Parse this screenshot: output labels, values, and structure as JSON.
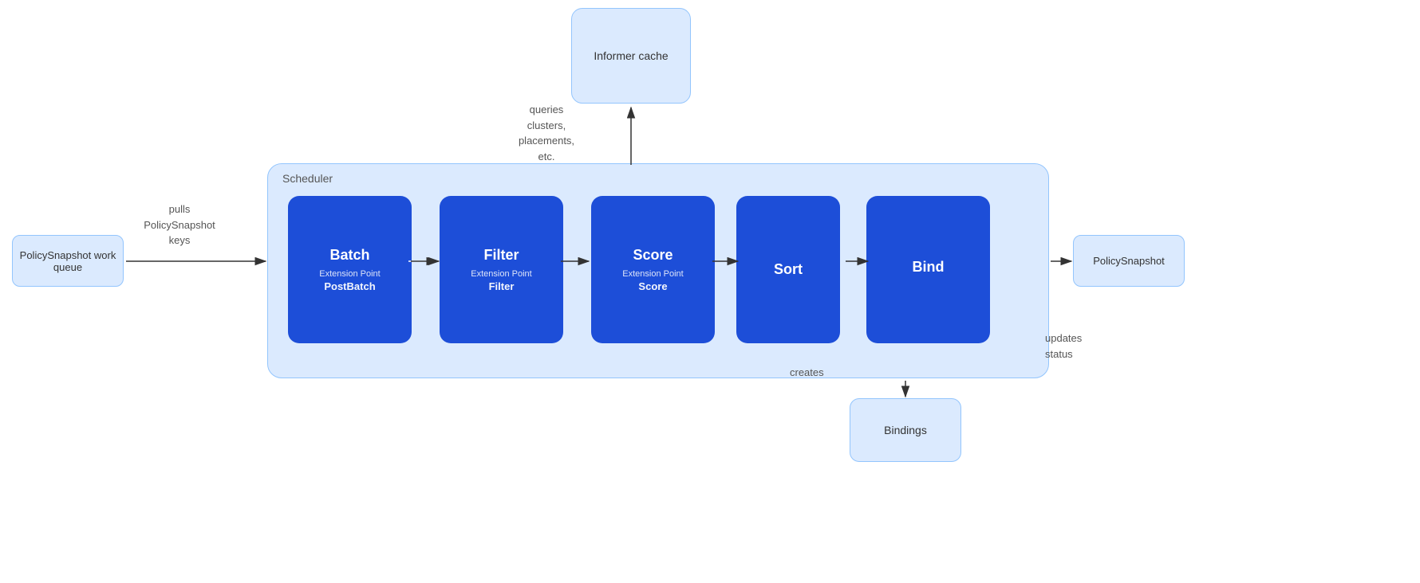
{
  "informer_cache": {
    "label": "Informer cache"
  },
  "policy_snapshot_queue": {
    "label": "PolicySnapshot work queue"
  },
  "policy_snapshot_output": {
    "label": "PolicySnapshot"
  },
  "bindings": {
    "label": "Bindings"
  },
  "scheduler": {
    "label": "Scheduler",
    "steps": [
      {
        "title": "Batch",
        "subtitle": "Extension Point",
        "subtitle_bold": "PostBatch"
      },
      {
        "title": "Filter",
        "subtitle": "Extension Point",
        "subtitle_bold": "Filter"
      },
      {
        "title": "Score",
        "subtitle": "Extension Point",
        "subtitle_bold": "Score"
      },
      {
        "title": "Sort",
        "subtitle": "",
        "subtitle_bold": ""
      },
      {
        "title": "Bind",
        "subtitle": "",
        "subtitle_bold": ""
      }
    ]
  },
  "labels": {
    "queries": "queries\nclusters,\nplacements,\netc.",
    "pulls": "pulls\nPolicySnapshot\nkeys",
    "creates": "creates",
    "updates": "updates\nstatus"
  }
}
